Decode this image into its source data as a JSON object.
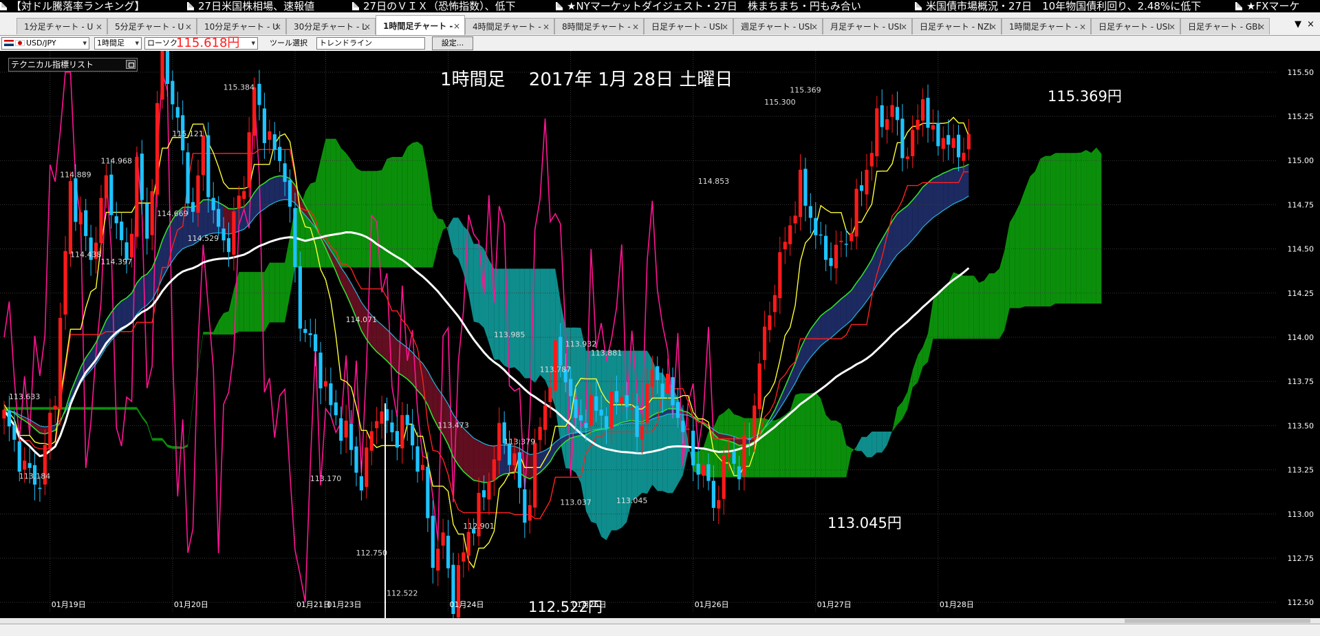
{
  "news": [
    {
      "text": "【対ドル騰落率ランキング】"
    },
    {
      "text": "27日米国株相場、速報値"
    },
    {
      "text": "27日のＶＩＸ（恐怖指数）、低下"
    },
    {
      "text": "★NYマーケットダイジェスト・27日　株まちまち・円もみ合い"
    },
    {
      "text": "米国債市場概況・27日　10年物国債利回り、2.48%に低下"
    },
    {
      "text": "★FXマーケ"
    }
  ],
  "tabs": [
    {
      "label": "1分足チャート - U"
    },
    {
      "label": "5分足チャート - U"
    },
    {
      "label": "10分足チャート - U"
    },
    {
      "label": "30分足チャート - L"
    },
    {
      "label": "1時間足チャート -"
    },
    {
      "label": "4時間足チャート -"
    },
    {
      "label": "8時間足チャート -"
    },
    {
      "label": "日足チャート - USI"
    },
    {
      "label": "週足チャート - USI"
    },
    {
      "label": "月足チャート - USI"
    },
    {
      "label": "日足チャート - NZI"
    },
    {
      "label": "1時間足チャート -"
    },
    {
      "label": "日足チャート - USI"
    },
    {
      "label": "日足チャート - GBI"
    }
  ],
  "tab_close_glyph": "×",
  "tabbar_controls": {
    "menu_glyph": "▼",
    "close_glyph": "×"
  },
  "toolbar": {
    "pair": "USD/JPY",
    "timeframe": "1時間足",
    "candle_type": "ローソク",
    "price": "115.618円",
    "tool_label": "ツール選択",
    "tool_value": "トレンドライン",
    "settings_button": "設定..."
  },
  "tech_panel": {
    "label": "テクニカル指標リスト"
  },
  "chart_title": "1時間足　 2017年 1月 28日 土曜日",
  "annotations": {
    "high": "115.369円",
    "low1": "113.045円",
    "low2": "112.522円"
  },
  "chart_data": {
    "type": "candlestick",
    "title": "1時間足　 2017年 1月 28日 土曜日",
    "xlabel": "",
    "ylabel": "",
    "ylim": [
      112.45,
      115.62
    ],
    "y_ticks": [
      "112.50",
      "112.75",
      "113.00",
      "113.25",
      "113.50",
      "113.75",
      "114.00",
      "114.25",
      "114.50",
      "114.75",
      "115.00",
      "115.25",
      "115.50"
    ],
    "x_ticks": [
      {
        "label": "01月19日",
        "index": 9
      },
      {
        "label": "01月20日",
        "index": 33
      },
      {
        "label": "01月21日",
        "index": 57
      },
      {
        "label": "01月23日",
        "index": 63
      },
      {
        "label": "01月24日",
        "index": 87
      },
      {
        "label": "01月25日",
        "index": 111
      },
      {
        "label": "01月26日",
        "index": 135
      },
      {
        "label": "01月27日",
        "index": 159
      },
      {
        "label": "01月28日",
        "index": 183
      }
    ],
    "grid": true,
    "colors": {
      "up": "#ff1a1a",
      "down": "#1ec3ff",
      "ma_white": "#ffffff",
      "ma_yellow": "#ffff33",
      "ma_red": "#ff2020",
      "ma_green": "#33dd33",
      "ma_cyan": "#22b8e0",
      "rsi_line": "#ff1493",
      "cloud_bull": "#1f2f6b",
      "cloud_bear": "#6b0f23",
      "span_green": "#0b8f0b",
      "span_teal": "#0f8d8d"
    },
    "price_keypoints": [
      [
        0,
        113.55
      ],
      [
        4,
        113.25
      ],
      [
        7,
        113.18
      ],
      [
        10,
        113.7
      ],
      [
        13,
        114.85
      ],
      [
        17,
        114.45
      ],
      [
        20,
        114.88
      ],
      [
        24,
        114.4
      ],
      [
        26,
        114.968
      ],
      [
        28,
        114.55
      ],
      [
        31,
        115.618
      ],
      [
        34,
        115.2
      ],
      [
        37,
        114.67
      ],
      [
        39,
        115.121
      ],
      [
        41,
        114.65
      ],
      [
        44,
        114.53
      ],
      [
        47,
        114.9
      ],
      [
        49,
        115.384
      ],
      [
        52,
        115.1
      ],
      [
        55,
        114.95
      ],
      [
        58,
        114.1
      ],
      [
        61,
        113.9
      ],
      [
        64,
        113.6
      ],
      [
        67,
        113.45
      ],
      [
        70,
        113.17
      ],
      [
        73,
        113.6
      ],
      [
        76,
        113.45
      ],
      [
        79,
        113.5
      ],
      [
        82,
        113.2
      ],
      [
        84,
        112.75
      ],
      [
        86,
        112.85
      ],
      [
        88,
        112.52
      ],
      [
        91,
        112.9
      ],
      [
        94,
        113.1
      ],
      [
        97,
        113.45
      ],
      [
        100,
        113.3
      ],
      [
        102,
        112.95
      ],
      [
        105,
        113.5
      ],
      [
        108,
        113.9
      ],
      [
        110,
        113.8
      ],
      [
        112,
        113.5
      ],
      [
        115,
        113.6
      ],
      [
        118,
        113.55
      ],
      [
        121,
        113.7
      ],
      [
        124,
        113.45
      ],
      [
        127,
        113.8
      ],
      [
        130,
        113.7
      ],
      [
        133,
        113.5
      ],
      [
        135,
        113.3
      ],
      [
        137,
        113.25
      ],
      [
        139,
        113.05
      ],
      [
        142,
        113.35
      ],
      [
        144,
        113.25
      ],
      [
        146,
        113.45
      ],
      [
        148,
        113.85
      ],
      [
        151,
        114.3
      ],
      [
        154,
        114.65
      ],
      [
        156,
        114.85
      ],
      [
        158,
        114.7
      ],
      [
        160,
        114.5
      ],
      [
        162,
        114.45
      ],
      [
        165,
        114.55
      ],
      [
        168,
        114.85
      ],
      [
        171,
        115.2
      ],
      [
        174,
        115.3
      ],
      [
        176,
        115.05
      ],
      [
        178,
        115.1
      ],
      [
        180,
        115.369
      ],
      [
        182,
        115.1
      ],
      [
        184,
        115.15
      ],
      [
        186,
        115.05
      ],
      [
        189,
        115.1
      ]
    ],
    "value_labels": [
      {
        "i": 4,
        "v": 113.633,
        "t": "113.633"
      },
      {
        "i": 6,
        "v": 113.184,
        "t": "113.184"
      },
      {
        "i": 14,
        "v": 114.889,
        "t": "114.889"
      },
      {
        "i": 16,
        "v": 114.438,
        "t": "114.438"
      },
      {
        "i": 22,
        "v": 114.968,
        "t": "114.968"
      },
      {
        "i": 22,
        "v": 114.397,
        "t": "114.397"
      },
      {
        "i": 30,
        "v": 115.618,
        "t": "115.618"
      },
      {
        "i": 33,
        "v": 114.669,
        "t": "114.669"
      },
      {
        "i": 36,
        "v": 115.121,
        "t": "115.121"
      },
      {
        "i": 39,
        "v": 114.529,
        "t": "114.529"
      },
      {
        "i": 46,
        "v": 115.384,
        "t": "115.384"
      },
      {
        "i": 63,
        "v": 113.17,
        "t": "113.170"
      },
      {
        "i": 70,
        "v": 114.071,
        "t": "114.071"
      },
      {
        "i": 72,
        "v": 112.75,
        "t": "112.750"
      },
      {
        "i": 78,
        "v": 112.522,
        "t": "112.522"
      },
      {
        "i": 88,
        "v": 113.473,
        "t": "113.473"
      },
      {
        "i": 93,
        "v": 112.901,
        "t": "112.901"
      },
      {
        "i": 99,
        "v": 113.985,
        "t": "113.985"
      },
      {
        "i": 101,
        "v": 113.379,
        "t": "113.379"
      },
      {
        "i": 108,
        "v": 113.787,
        "t": "113.787"
      },
      {
        "i": 112,
        "v": 113.037,
        "t": "113.037"
      },
      {
        "i": 113,
        "v": 113.932,
        "t": "113.932"
      },
      {
        "i": 118,
        "v": 113.881,
        "t": "113.881"
      },
      {
        "i": 123,
        "v": 113.045,
        "t": "113.045"
      },
      {
        "i": 139,
        "v": 114.853,
        "t": "114.853"
      },
      {
        "i": 152,
        "v": 115.3,
        "t": "115.300"
      },
      {
        "i": 157,
        "v": 115.369,
        "t": "115.369"
      }
    ]
  }
}
